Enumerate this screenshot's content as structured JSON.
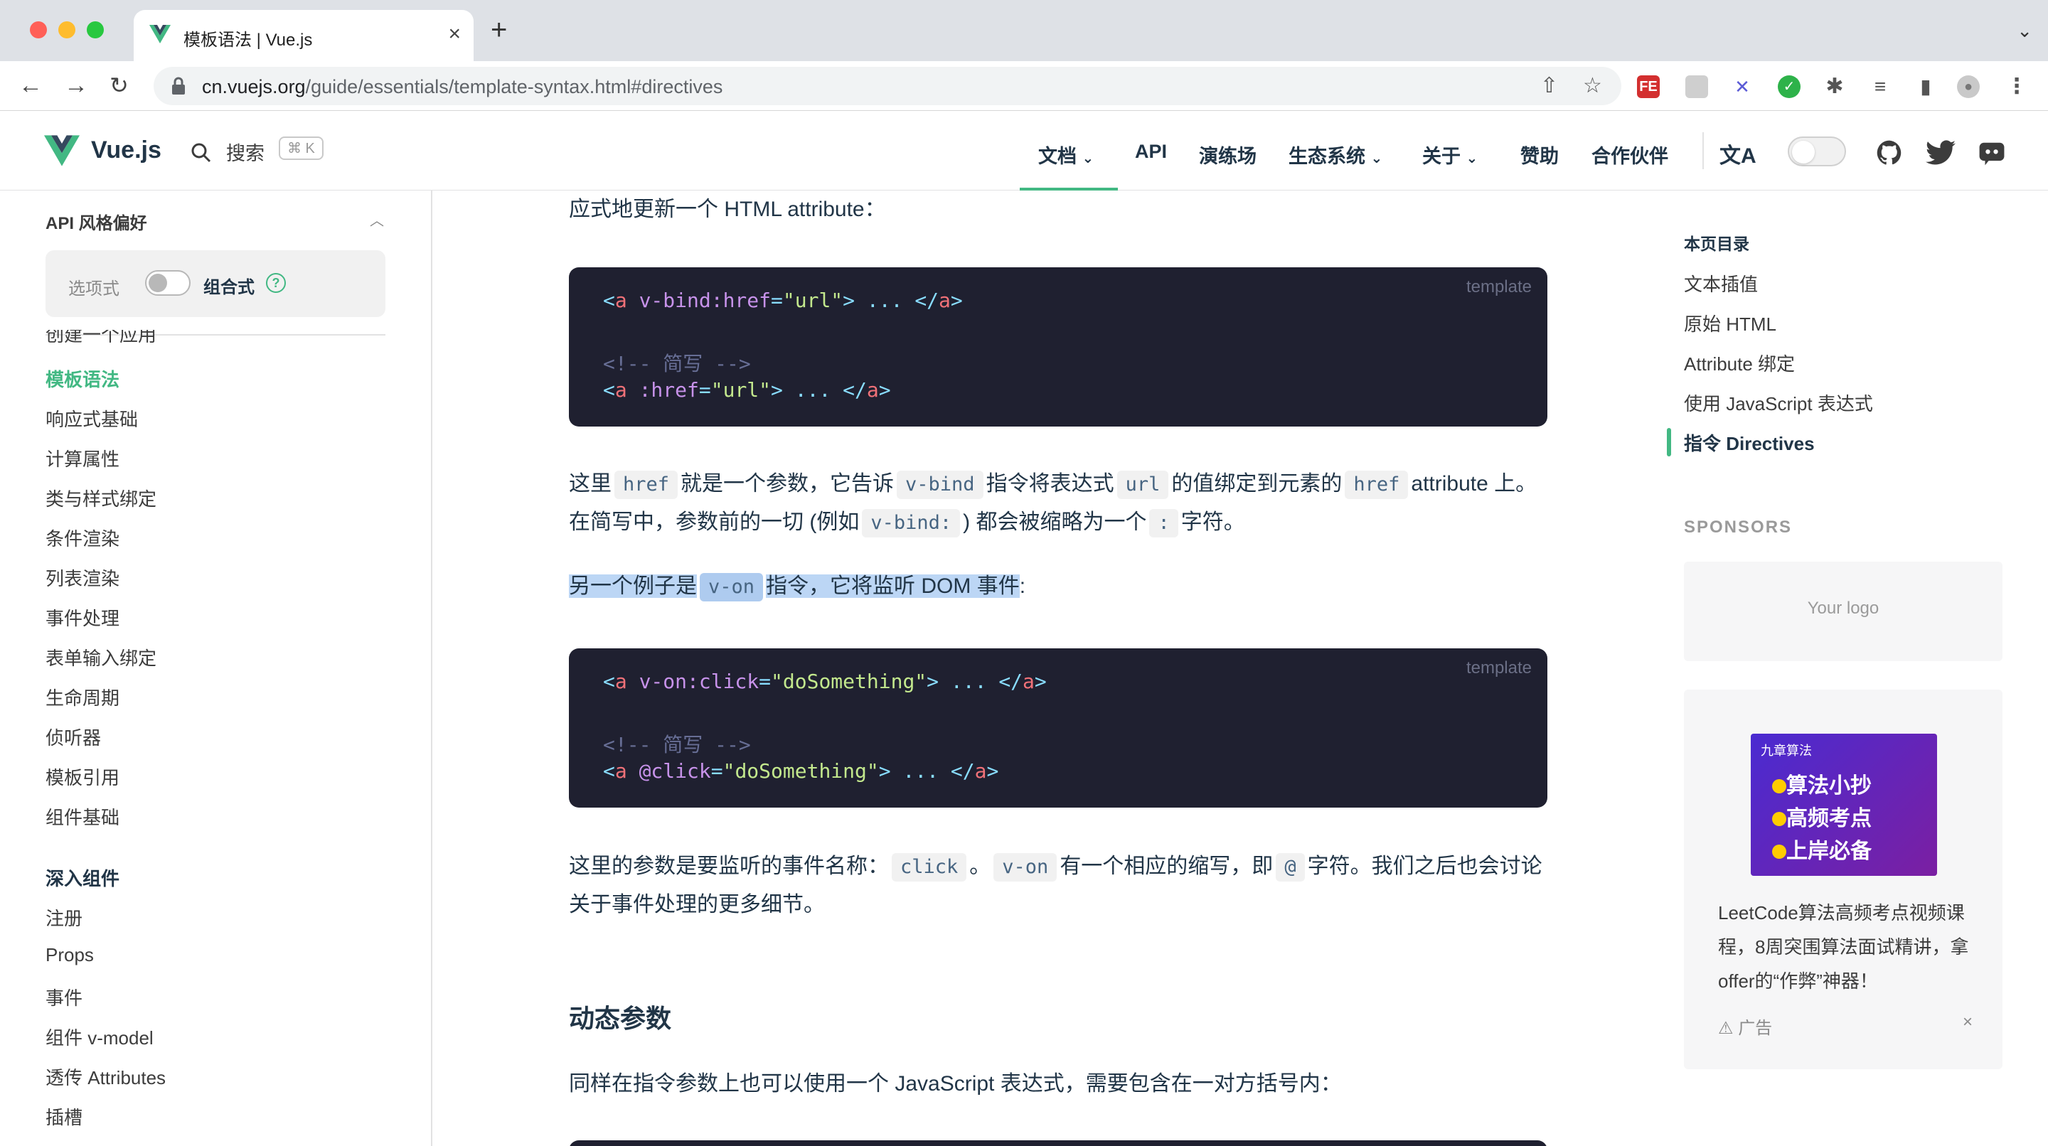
{
  "browser": {
    "tab_title": "模板语法 | Vue.js",
    "url_host": "cn.vuejs.org",
    "url_path": "/guide/essentials/template-syntax.html#directives"
  },
  "header": {
    "brand": "Vue.js",
    "search_label": "搜索",
    "search_shortcut": "⌘ K",
    "nav": [
      {
        "label": "文档"
      },
      {
        "label": "API"
      },
      {
        "label": "演练场"
      },
      {
        "label": "生态系统"
      },
      {
        "label": "关于"
      },
      {
        "label": "赞助"
      },
      {
        "label": "合作伙伴"
      }
    ]
  },
  "sidebar": {
    "api_pref": "API 风格偏好",
    "options_label": "选项式",
    "composition_label": "组合式",
    "partial_item": "创建一个应用",
    "items": [
      {
        "label": "模板语法",
        "active": true
      },
      {
        "label": "响应式基础"
      },
      {
        "label": "计算属性"
      },
      {
        "label": "类与样式绑定"
      },
      {
        "label": "条件渲染"
      },
      {
        "label": "列表渲染"
      },
      {
        "label": "事件处理"
      },
      {
        "label": "表单输入绑定"
      },
      {
        "label": "生命周期"
      },
      {
        "label": "侦听器"
      },
      {
        "label": "模板引用"
      },
      {
        "label": "组件基础"
      }
    ],
    "group_title": "深入组件",
    "group_items": [
      {
        "label": "注册"
      },
      {
        "label": "Props"
      },
      {
        "label": "事件"
      },
      {
        "label": "组件 v-model"
      },
      {
        "label": "透传 Attributes"
      },
      {
        "label": "插槽"
      }
    ]
  },
  "content": {
    "p1": "应式地更新一个 HTML attribute：",
    "code1_lang": "template",
    "code1": {
      "line1": {
        "open": "<",
        "tag": "a",
        "attr": " v-bind:href",
        "eq": "=",
        "str": "\"url\"",
        "rest": "> ... </",
        "tag2": "a",
        "close": ">"
      },
      "comment": "<!-- 简写 -->",
      "line3": {
        "open": "<",
        "tag": "a",
        "attr": " :href",
        "eq": "=",
        "str": "\"url\"",
        "rest": "> ... </",
        "tag2": "a",
        "close": ">"
      }
    },
    "p2": {
      "a": "这里",
      "c1": "href",
      "b": "就是一个参数，它告诉",
      "c2": "v-bind",
      "c": "指令将表达式",
      "c3": "url",
      "d": "的值绑定到元素的",
      "c4": "href",
      "e": "attribute 上。在简写中，参数前的一切 (例如",
      "c5": "v-bind:",
      "f": ") 都会被缩略为一个",
      "c6": ":",
      "g": "字符。"
    },
    "p3": {
      "a": "另一个例子是",
      "c1": "v-on",
      "b": "指令，它将监听 DOM 事件",
      "end": ":"
    },
    "code2_lang": "template",
    "code2": {
      "line1": {
        "open": "<",
        "tag": "a",
        "attr": " v-on:click",
        "eq": "=",
        "str": "\"doSomething\"",
        "rest": "> ... </",
        "tag2": "a",
        "close": ">"
      },
      "comment": "<!-- 简写 -->",
      "line3": {
        "open": "<",
        "tag": "a",
        "attr": " @click",
        "eq": "=",
        "str": "\"doSomething\"",
        "rest": "> ... </",
        "tag2": "a",
        "close": ">"
      }
    },
    "p4": {
      "a": "这里的参数是要监听的事件名称：",
      "c1": "click",
      "b": "。",
      "c2": "v-on",
      "c": "有一个相应的缩写，即",
      "c3": "@",
      "d": "字符。我们之后也会讨论关于事件处理的更多细节。"
    },
    "h2": "动态参数",
    "p5": "同样在指令参数上也可以使用一个 JavaScript 表达式，需要包含在一对方括号内："
  },
  "aside": {
    "toc_title": "本页目录",
    "toc": [
      {
        "label": "文本插值"
      },
      {
        "label": "原始 HTML"
      },
      {
        "label": "Attribute 绑定"
      },
      {
        "label": "使用 JavaScript 表达式"
      },
      {
        "label": "指令 Directives",
        "active": true
      }
    ],
    "sponsors": "SPONSORS",
    "your_logo": "Your logo",
    "ad_image": {
      "brand": "九章算法",
      "line1": "算法小抄",
      "line2": "高频考点",
      "line3": "上岸必备"
    },
    "ad_text": "LeetCode算法高频考点视频课程，8周突围算法面试精讲，拿offer的“作弊”神器！",
    "ad_label": "广告",
    "ad_close": "×"
  },
  "colors": {
    "accent": "#42b883",
    "code_bg": "#1f2030",
    "highlight": "#bcd6f5"
  }
}
